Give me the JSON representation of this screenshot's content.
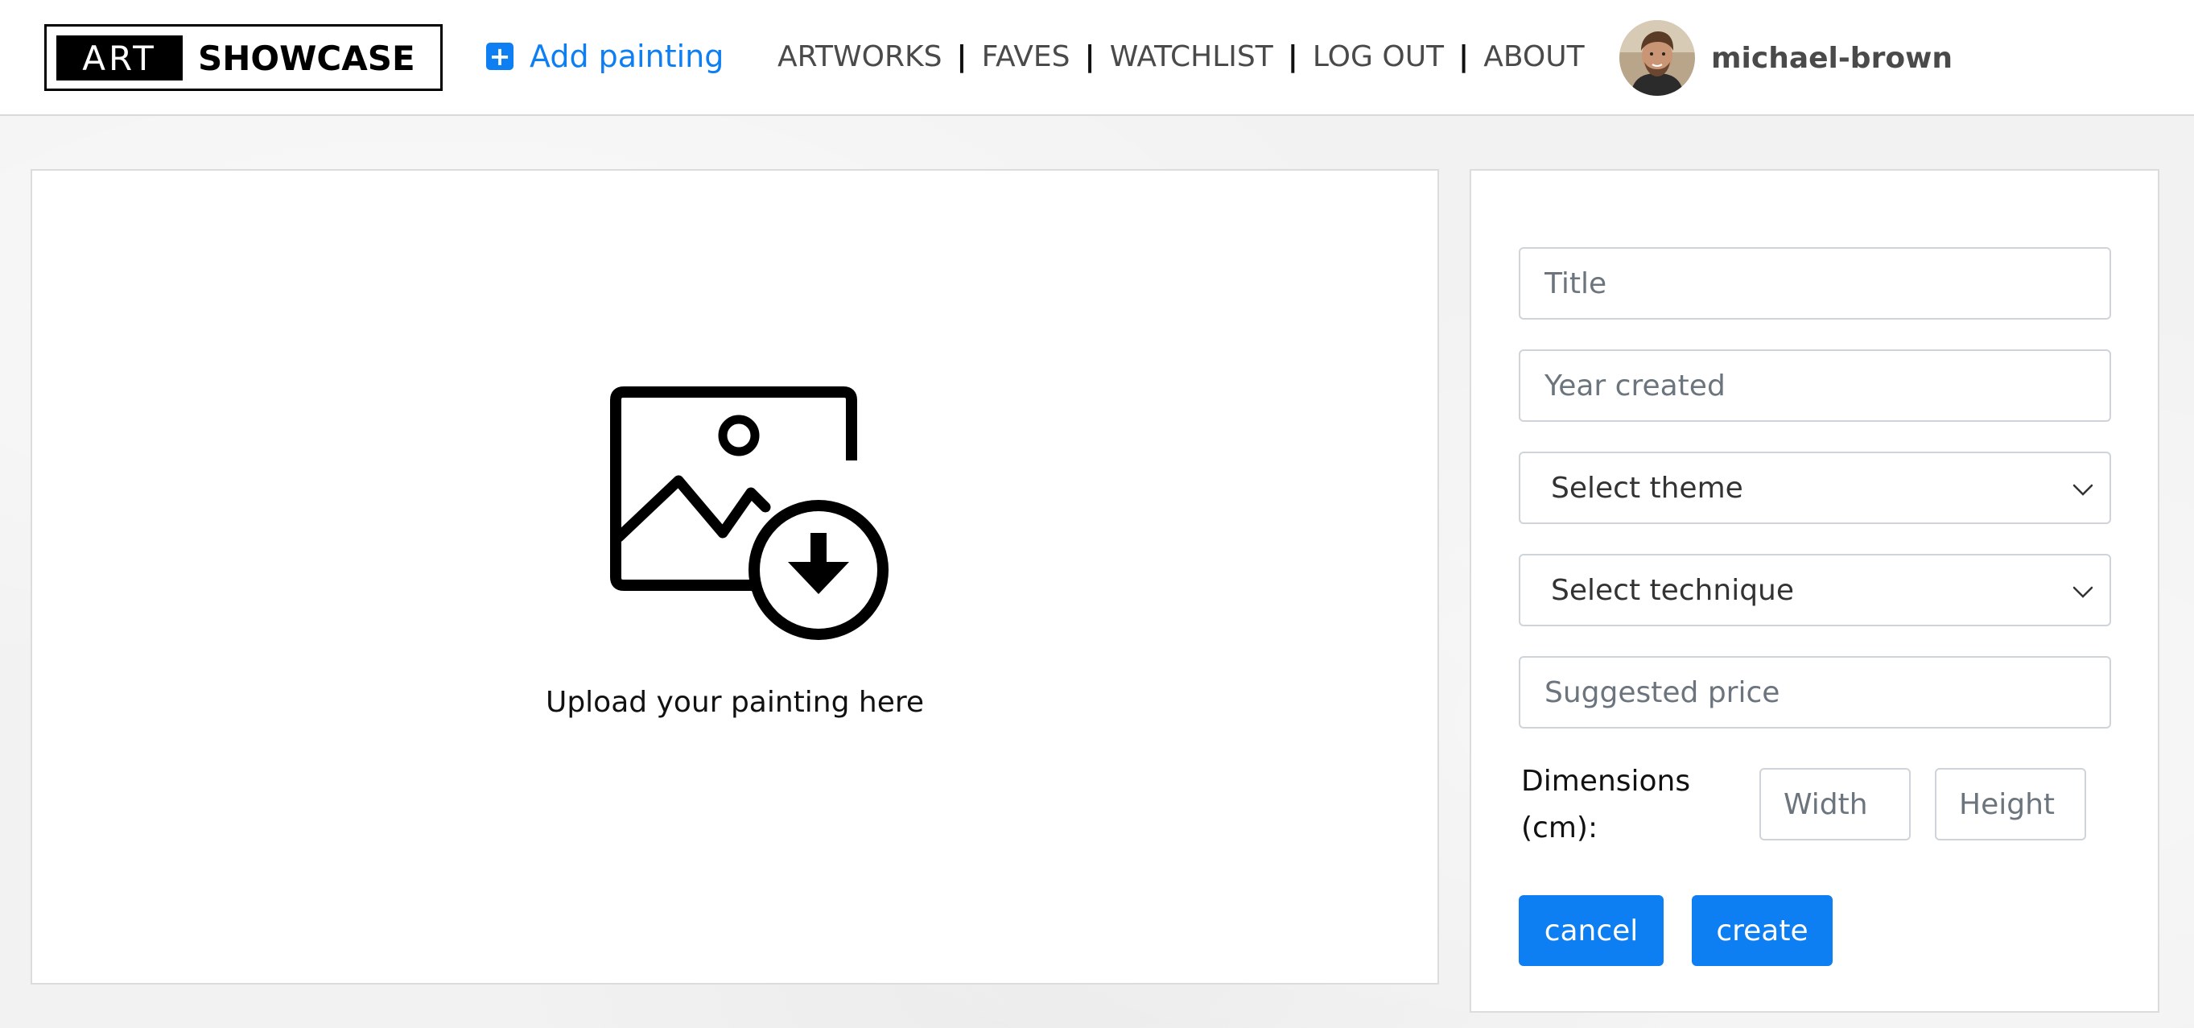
{
  "brand": {
    "word1": "ART",
    "word2": "SHOWCASE"
  },
  "nav": {
    "add_label": "Add painting",
    "add_icon": "plus-square-icon",
    "links": [
      "ARTWORKS",
      "FAVES",
      "WATCHLIST",
      "LOG OUT",
      "ABOUT"
    ],
    "separator": "|"
  },
  "user": {
    "name": "michael-brown",
    "avatar": "user-avatar-photo"
  },
  "upload": {
    "icon": "image-download-icon",
    "text": "Upload your painting here"
  },
  "form": {
    "title_placeholder": "Title",
    "year_placeholder": "Year created",
    "theme_selected": "Select theme",
    "technique_selected": "Select technique",
    "price_placeholder": "Suggested price",
    "dimensions_label": "Dimensions (cm):",
    "width_placeholder": "Width",
    "height_placeholder": "Height",
    "cancel_label": "cancel",
    "create_label": "create"
  },
  "colors": {
    "accent": "#0d7ff2",
    "navbar_bg": "#ffffff",
    "page_bg": "#f2f2f2"
  }
}
